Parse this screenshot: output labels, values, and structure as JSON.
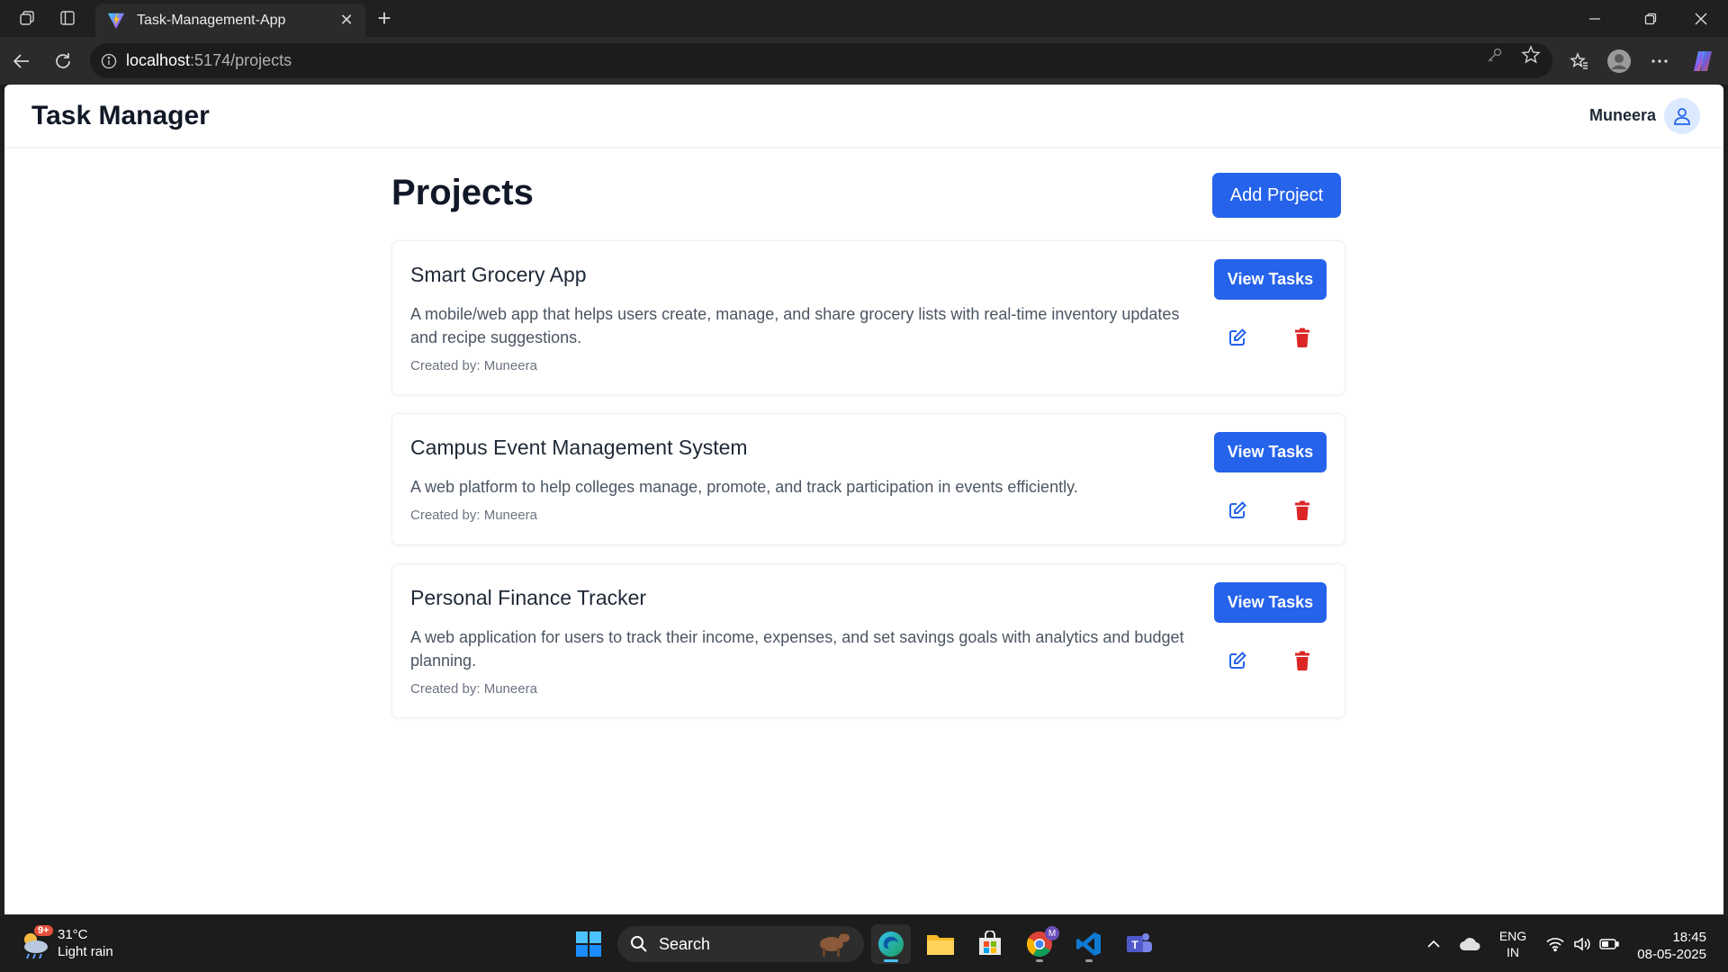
{
  "browser": {
    "tab_title": "Task-Management-App",
    "url_host": "localhost",
    "url_path": ":5174/projects"
  },
  "app": {
    "brand": "Task Manager",
    "user_name": "Muneera"
  },
  "page": {
    "title": "Projects",
    "add_button": "Add Project"
  },
  "projects": [
    {
      "name": "Smart Grocery App",
      "description": "A mobile/web app that helps users create, manage, and share grocery lists with real-time inventory updates and recipe suggestions.",
      "created_by": "Created by: Muneera",
      "view_label": "View Tasks"
    },
    {
      "name": "Campus Event Management System",
      "description": "A web platform to help colleges manage, promote, and track participation in events efficiently.",
      "created_by": "Created by: Muneera",
      "view_label": "View Tasks"
    },
    {
      "name": "Personal Finance Tracker",
      "description": "A web application for users to track their income, expenses, and set savings goals with analytics and budget planning.",
      "created_by": "Created by: Muneera",
      "view_label": "View Tasks"
    }
  ],
  "taskbar": {
    "weather_badge": "9+",
    "temperature": "31°C",
    "condition": "Light rain",
    "search_label": "Search",
    "lang_line1": "ENG",
    "lang_line2": "IN",
    "time": "18:45",
    "date": "08-05-2025",
    "chrome_profile_badge": "M"
  },
  "colors": {
    "primary": "#2563eb",
    "danger": "#dc2626",
    "heading": "#111827"
  }
}
